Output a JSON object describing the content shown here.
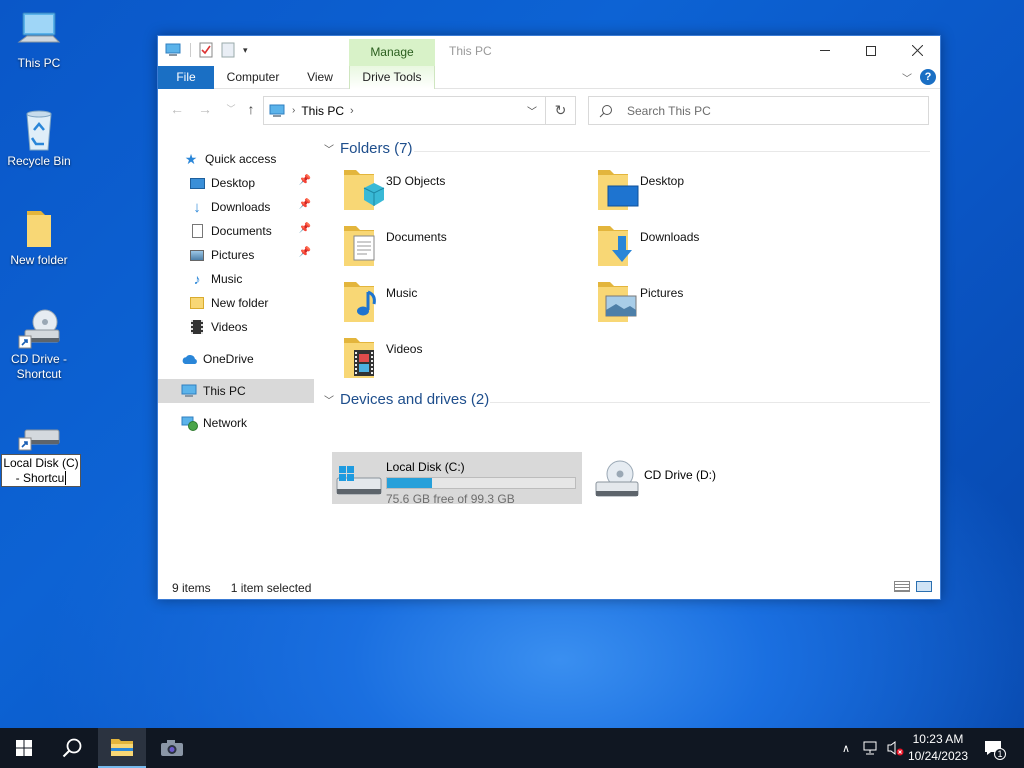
{
  "desktop": {
    "icons": [
      {
        "label": "This PC",
        "icon": "this-pc-icon"
      },
      {
        "label": "Recycle Bin",
        "icon": "recycle-bin-icon"
      },
      {
        "label": "New folder",
        "icon": "folder-icon"
      },
      {
        "label": "CD Drive -\nShortcut",
        "icon": "cd-drive-shortcut-icon"
      }
    ],
    "rename_field": {
      "line1": "Local Disk (C)",
      "line2": "- Shortcu",
      "icon": "local-disk-shortcut-icon"
    }
  },
  "window": {
    "title": "This PC",
    "contextual_tab_group": "Manage",
    "ribbon_tabs": [
      "File",
      "Computer",
      "View",
      "Drive Tools"
    ],
    "address_path": [
      "This PC"
    ],
    "search_placeholder": "Search This PC",
    "nav_pane": {
      "quick_access": "Quick access",
      "pinned": [
        {
          "label": "Desktop",
          "pinned": true
        },
        {
          "label": "Downloads",
          "pinned": true
        },
        {
          "label": "Documents",
          "pinned": true
        },
        {
          "label": "Pictures",
          "pinned": true
        },
        {
          "label": "Music",
          "pinned": false
        },
        {
          "label": "New folder",
          "pinned": false
        },
        {
          "label": "Videos",
          "pinned": false
        }
      ],
      "onedrive": "OneDrive",
      "this_pc": "This PC",
      "network": "Network"
    },
    "folders_header": "Folders (7)",
    "folders": [
      "3D Objects",
      "Desktop",
      "Documents",
      "Downloads",
      "Music",
      "Pictures",
      "Videos"
    ],
    "devices_header": "Devices and drives (2)",
    "drives": [
      {
        "name": "Local Disk (C:)",
        "free_text": "75.6 GB free of 99.3 GB",
        "used_fraction": 0.239,
        "selected": true
      },
      {
        "name": "CD Drive (D:)"
      }
    ],
    "status": {
      "items": "9 items",
      "selected": "1 item selected"
    }
  },
  "taskbar": {
    "time": "10:23 AM",
    "date": "10/24/2023",
    "notification_count": "1",
    "accent": "#26a0da"
  }
}
